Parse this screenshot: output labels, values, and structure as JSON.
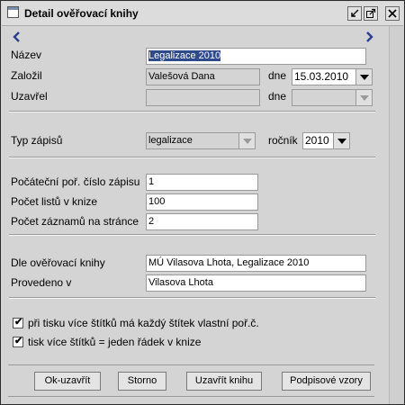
{
  "window": {
    "title": "Detail ověřovací knihy"
  },
  "fields": {
    "nazev_label": "Název",
    "nazev_value": "Legalizace 2010",
    "zalozil_label": "Založil",
    "zalozil_value": "Valešová Dana",
    "dne_label": "dne",
    "zalozil_date": "15.03.2010",
    "uzavrel_label": "Uzavřel",
    "uzavrel_value": "",
    "dne2_label": "dne",
    "uzavrel_date": "",
    "typ_label": "Typ zápisů",
    "typ_value": "legalizace",
    "rocnik_label": "ročník",
    "rocnik_value": "2010",
    "pocatecni_label": "Počáteční poř. číslo zápisu",
    "pocatecni_value": "1",
    "listu_label": "Počet listů v knize",
    "listu_value": "100",
    "zaznamu_label": "Počet záznamů na stránce",
    "zaznamu_value": "2",
    "dle_label": "Dle ověřovací knihy",
    "dle_value": "MÚ Vilasova Lhota, Legalizace 2010",
    "provedeno_label": "Provedeno v",
    "provedeno_value": "Vilasova Lhota"
  },
  "checkboxes": [
    {
      "label": "při tisku více štítků má každý štítek vlastní poř.č.",
      "checked": true
    },
    {
      "label": "tisk více štítků = jeden řádek v knize",
      "checked": true
    }
  ],
  "buttons": {
    "ok": "Ok-uzavřít",
    "storno": "Storno",
    "uzavrit": "Uzavřít knihu",
    "podpisy": "Podpisové vzory"
  },
  "colors": {
    "nav_arrow": "#2b3f8c"
  }
}
